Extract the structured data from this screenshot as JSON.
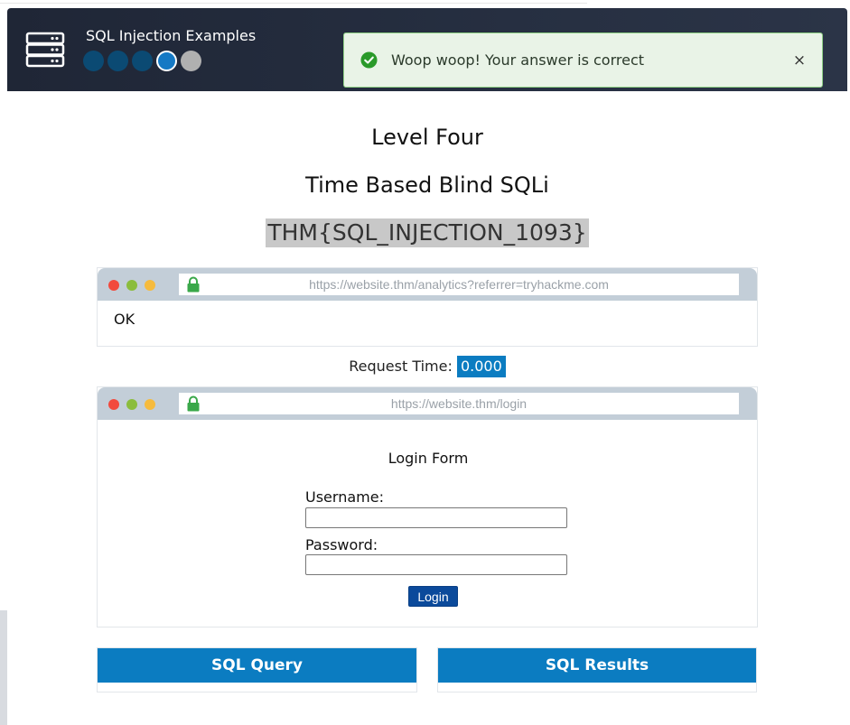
{
  "app": {
    "title": "SQL Injection Examples",
    "progress": {
      "total_levels": 5,
      "completed": 3,
      "current": 4
    }
  },
  "toast": {
    "message": "Woop woop! Your answer is correct",
    "close_label": "×"
  },
  "level": {
    "heading": "Level Four",
    "subheading": "Time Based Blind SQLi",
    "flag": "THM{SQL_INJECTION_1093}"
  },
  "analytics_browser": {
    "url": "https://website.thm/analytics?referrer=tryhackme.com",
    "response": "OK"
  },
  "request_time": {
    "label": "Request Time:",
    "value": "0.000"
  },
  "login_browser": {
    "url": "https://website.thm/login",
    "form_title": "Login Form",
    "username_label": "Username:",
    "username_value": "",
    "password_label": "Password:",
    "password_value": "",
    "submit_label": "Login"
  },
  "panels": {
    "query_title": "SQL Query",
    "results_title": "SQL Results"
  },
  "colors": {
    "header_bg": "#262f41",
    "accent": "#0b7cc1",
    "toast_bg": "#e9f3e7",
    "toast_border": "#8dcf84",
    "flag_bg": "#c8c8c8"
  }
}
